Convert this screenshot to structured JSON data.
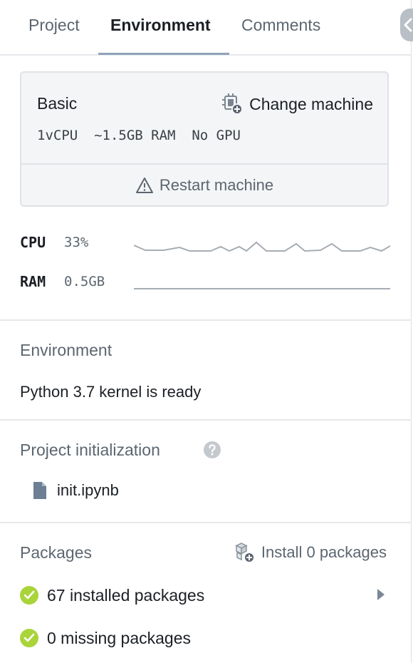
{
  "tabs": [
    {
      "label": "Project",
      "active": false
    },
    {
      "label": "Environment",
      "active": true
    },
    {
      "label": "Comments",
      "active": false
    }
  ],
  "machine": {
    "name": "Basic",
    "specs": "1vCPU  ~1.5GB RAM  No GPU",
    "change_label": "Change machine",
    "restart_label": "Restart machine"
  },
  "metrics": {
    "cpu_label": "CPU",
    "cpu_value": "33%",
    "ram_label": "RAM",
    "ram_value": "0.5GB"
  },
  "environment": {
    "title": "Environment",
    "status": "Python 3.7 kernel is ready"
  },
  "initialization": {
    "title": "Project initialization",
    "file": "init.ipynb"
  },
  "packages": {
    "title": "Packages",
    "install_label": "Install 0 packages",
    "installed": "67 installed packages",
    "missing": "0 missing packages"
  },
  "colors": {
    "accent_underline": "#8fa3b8",
    "check_green": "#a9d43a",
    "muted_text": "#5c6670",
    "sparkline": "#a7adb4"
  },
  "icons": [
    "chevron-left-icon",
    "chip-add-icon",
    "warning-icon",
    "help-icon",
    "file-icon",
    "package-add-icon",
    "check-circle-icon",
    "caret-right-icon"
  ]
}
